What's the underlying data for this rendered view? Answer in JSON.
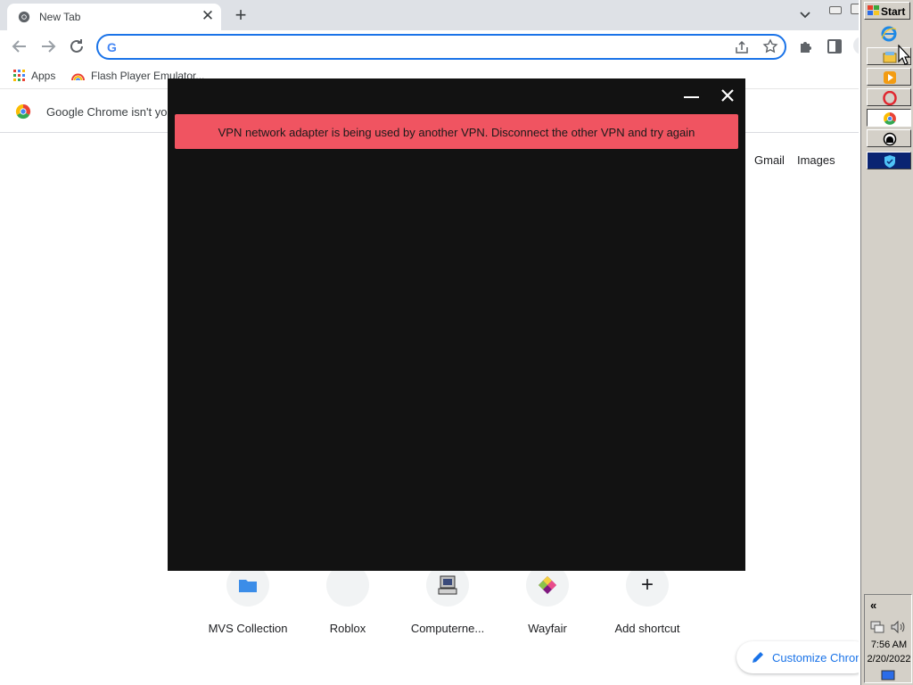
{
  "browser": {
    "tab": {
      "title": "New Tab",
      "close_label": "✕"
    },
    "new_tab_label": "+",
    "omnibox": {
      "value": "",
      "placeholder": ""
    },
    "bookmarks": [
      {
        "label": "Apps",
        "icon": "apps-grid-icon"
      },
      {
        "label": "Flash Player Emulator...",
        "icon": "rainbow-icon"
      }
    ],
    "infobar": {
      "message": "Google Chrome isn't your"
    },
    "header_links": {
      "gmail": "Gmail",
      "images": "Images"
    },
    "shortcuts": [
      {
        "label": "MVS Collection",
        "icon": "folder-icon"
      },
      {
        "label": "Roblox",
        "icon": "blank-icon"
      },
      {
        "label": "Computerne...",
        "icon": "computer-icon"
      },
      {
        "label": "Wayfair",
        "icon": "wayfair-icon"
      },
      {
        "label": "Add shortcut",
        "icon": "plus-icon"
      }
    ],
    "add_glyph": "+",
    "customize_label": "Customize Chrome"
  },
  "vpn": {
    "error_message": "VPN network adapter is being used by another VPN. Disconnect the other VPN and try again",
    "colors": {
      "background": "#121212",
      "error": "#f05461"
    }
  },
  "taskbar": {
    "start_label": "Start",
    "tray_chevron": "«",
    "time": "7:56 AM",
    "date": "2/20/2022",
    "buttons": [
      "file-manager-icon",
      "media-player-icon",
      "opera-icon",
      "chrome-icon",
      "headset-icon",
      "shield-icon"
    ]
  }
}
